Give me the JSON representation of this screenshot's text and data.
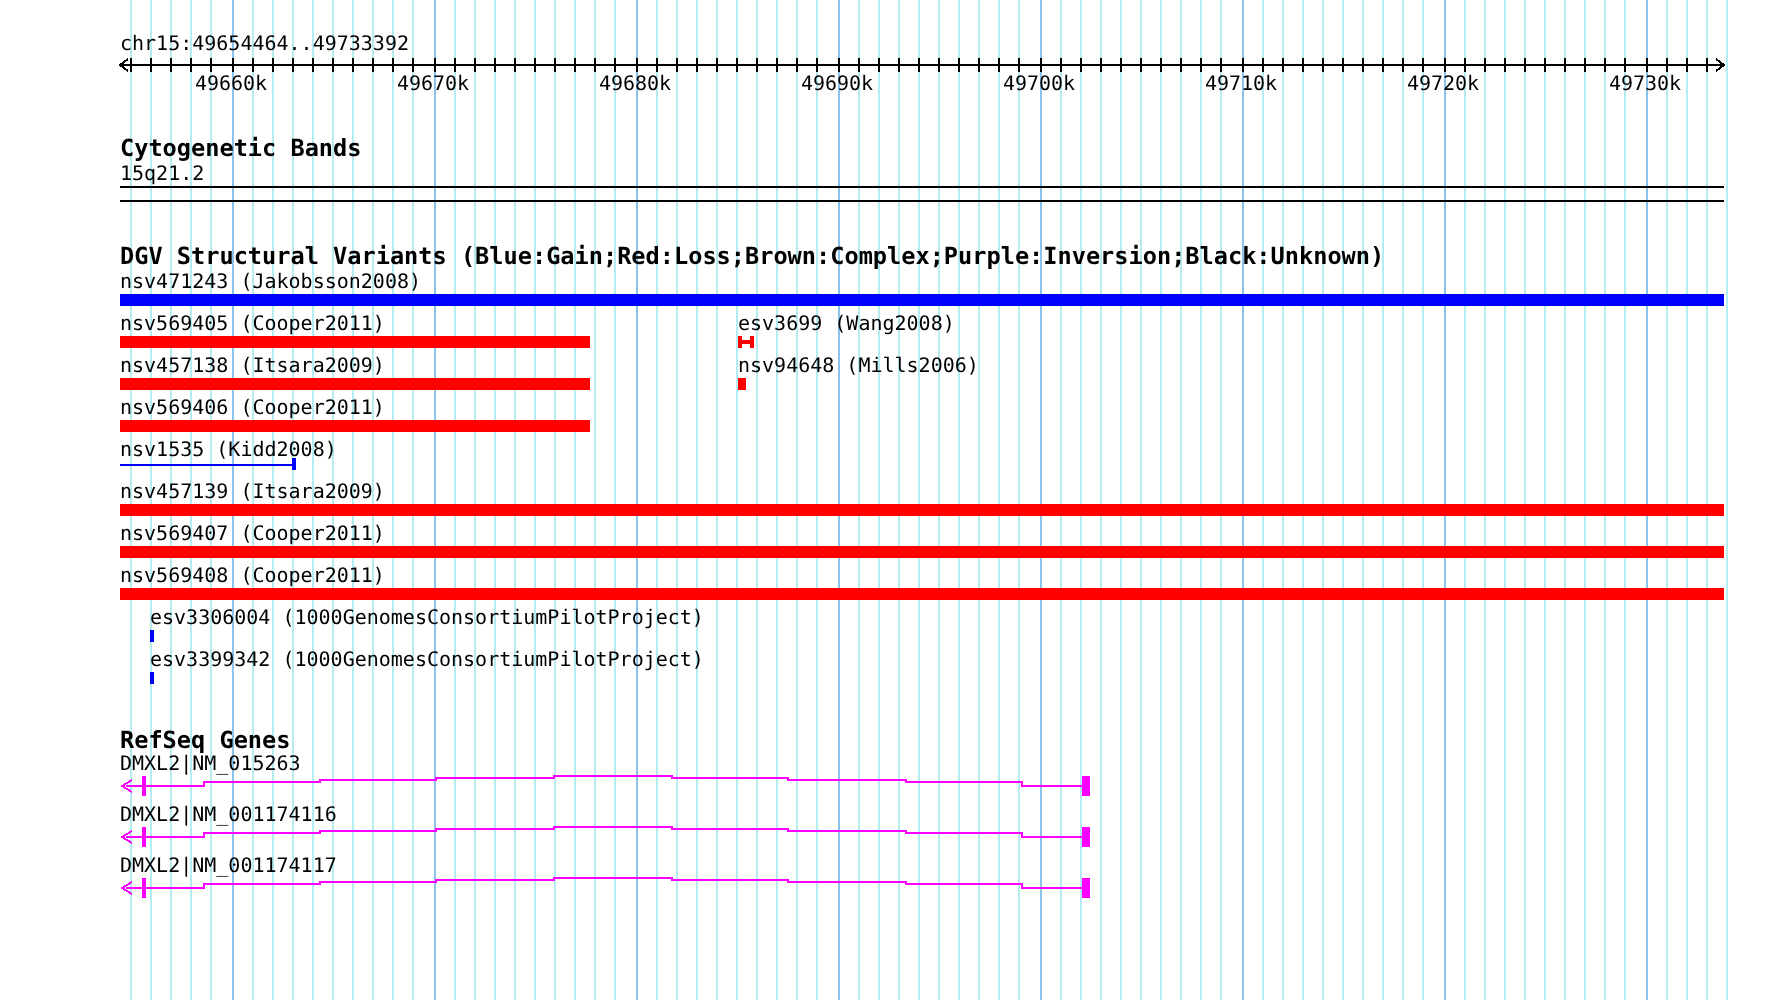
{
  "ruler": {
    "label": "chr15:49654464..49733392",
    "ticks": [
      "49660k",
      "49670k",
      "49680k",
      "49690k",
      "49700k",
      "49710k",
      "49720k",
      "49730k"
    ]
  },
  "tracks": [
    {
      "kind": "cytoband",
      "title": "Cytogenetic Bands",
      "label": "15q21.2"
    },
    {
      "kind": "variants",
      "title": "DGV Structural Variants (Blue:Gain;Red:Loss;Brown:Complex;Purple:Inversion;Black:Unknown)",
      "features": [
        {
          "label": "nsv471243 (Jakobsson2008)",
          "color": "#0000ff"
        },
        {
          "label": "nsv569405 (Cooper2011)",
          "color": "#ff0000"
        },
        {
          "label": "esv3699 (Wang2008)",
          "color": "#ff0000"
        },
        {
          "label": "nsv457138 (Itsara2009)",
          "color": "#ff0000"
        },
        {
          "label": "nsv94648 (Mills2006)",
          "color": "#ff0000"
        },
        {
          "label": "nsv569406 (Cooper2011)",
          "color": "#ff0000"
        },
        {
          "label": "nsv1535 (Kidd2008)",
          "color": "#0000ff"
        },
        {
          "label": "nsv457139 (Itsara2009)",
          "color": "#ff0000"
        },
        {
          "label": "nsv569407 (Cooper2011)",
          "color": "#ff0000"
        },
        {
          "label": "nsv569408 (Cooper2011)",
          "color": "#ff0000"
        },
        {
          "label": "esv3306004 (1000GenomesConsortiumPilotProject)",
          "color": "#0000ff"
        },
        {
          "label": "esv3399342 (1000GenomesConsortiumPilotProject)",
          "color": "#0000ff"
        }
      ]
    },
    {
      "kind": "genes",
      "title": "RefSeq Genes",
      "features": [
        {
          "label": "DMXL2|NM_015263"
        },
        {
          "label": "DMXL2|NM_001174116"
        },
        {
          "label": "DMXL2|NM_001174117"
        }
      ]
    }
  ]
}
